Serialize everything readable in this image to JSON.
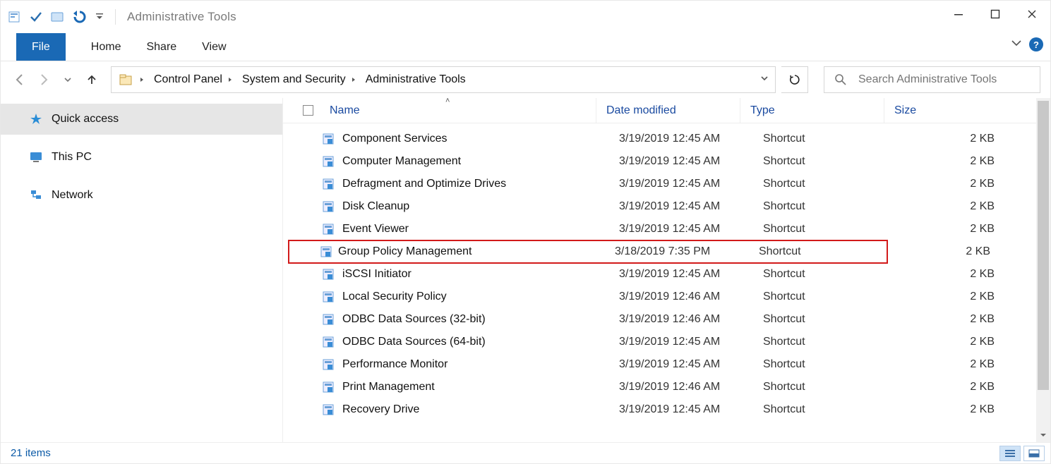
{
  "title": "Administrative Tools",
  "ribbon": {
    "file": "File",
    "tabs": [
      "Home",
      "Share",
      "View"
    ]
  },
  "breadcrumbs": [
    "Control Panel",
    "System and Security",
    "Administrative Tools"
  ],
  "search_placeholder": "Search Administrative Tools",
  "sidebar": {
    "items": [
      {
        "label": "Quick access",
        "selected": true
      },
      {
        "label": "This PC",
        "selected": false
      },
      {
        "label": "Network",
        "selected": false
      }
    ]
  },
  "columns": {
    "name": "Name",
    "date": "Date modified",
    "type": "Type",
    "size": "Size"
  },
  "rows": [
    {
      "name": "Component Services",
      "date": "3/19/2019 12:45 AM",
      "type": "Shortcut",
      "size": "2 KB",
      "hi": false
    },
    {
      "name": "Computer Management",
      "date": "3/19/2019 12:45 AM",
      "type": "Shortcut",
      "size": "2 KB",
      "hi": false
    },
    {
      "name": "Defragment and Optimize Drives",
      "date": "3/19/2019 12:45 AM",
      "type": "Shortcut",
      "size": "2 KB",
      "hi": false
    },
    {
      "name": "Disk Cleanup",
      "date": "3/19/2019 12:45 AM",
      "type": "Shortcut",
      "size": "2 KB",
      "hi": false
    },
    {
      "name": "Event Viewer",
      "date": "3/19/2019 12:45 AM",
      "type": "Shortcut",
      "size": "2 KB",
      "hi": false
    },
    {
      "name": "Group Policy Management",
      "date": "3/18/2019 7:35 PM",
      "type": "Shortcut",
      "size": "2 KB",
      "hi": true
    },
    {
      "name": "iSCSI Initiator",
      "date": "3/19/2019 12:45 AM",
      "type": "Shortcut",
      "size": "2 KB",
      "hi": false
    },
    {
      "name": "Local Security Policy",
      "date": "3/19/2019 12:46 AM",
      "type": "Shortcut",
      "size": "2 KB",
      "hi": false
    },
    {
      "name": "ODBC Data Sources (32-bit)",
      "date": "3/19/2019 12:46 AM",
      "type": "Shortcut",
      "size": "2 KB",
      "hi": false
    },
    {
      "name": "ODBC Data Sources (64-bit)",
      "date": "3/19/2019 12:45 AM",
      "type": "Shortcut",
      "size": "2 KB",
      "hi": false
    },
    {
      "name": "Performance Monitor",
      "date": "3/19/2019 12:45 AM",
      "type": "Shortcut",
      "size": "2 KB",
      "hi": false
    },
    {
      "name": "Print Management",
      "date": "3/19/2019 12:46 AM",
      "type": "Shortcut",
      "size": "2 KB",
      "hi": false
    },
    {
      "name": "Recovery Drive",
      "date": "3/19/2019 12:45 AM",
      "type": "Shortcut",
      "size": "2 KB",
      "hi": false
    }
  ],
  "status": "21 items",
  "colors": {
    "accent": "#1a69b5",
    "hilite": "#d21a1a"
  }
}
